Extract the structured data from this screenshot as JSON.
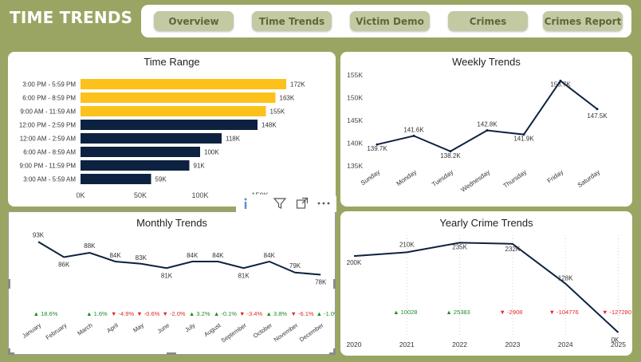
{
  "header": {
    "title": "TIME TRENDS"
  },
  "nav": {
    "items": [
      "Overview",
      "Time Trends",
      "Victim Demo",
      "Crimes",
      "Crimes Report"
    ]
  },
  "colors": {
    "gold": "#fcc21b",
    "navy": "#0d2240",
    "green": "#1e8a2a",
    "red": "#e0262a",
    "olive": "#9ba563"
  },
  "visual_toolbar": {
    "icons": [
      "info-icon",
      "filter-icon",
      "focus-mode-icon",
      "more-options-icon"
    ]
  },
  "time_range": {
    "title": "Time Range",
    "chart_data": {
      "type": "bar",
      "orientation": "horizontal",
      "categories": [
        "3:00 PM - 5:59 PM",
        "6:00 PM - 8:59 PM",
        "9:00 AM - 11:59 AM",
        "12:00 PM - 2:59 PM",
        "12:00 AM - 2:59 AM",
        "6:00 AM - 8:59 AM",
        "9:00 PM - 11:59 PM",
        "3:00 AM - 5:59 AM"
      ],
      "values": [
        172000,
        163000,
        155000,
        148000,
        118000,
        100000,
        91000,
        59000
      ],
      "labels": [
        "172K",
        "163K",
        "155K",
        "148K",
        "118K",
        "100K",
        "91K",
        "59K"
      ],
      "highlight": [
        true,
        true,
        true,
        false,
        false,
        false,
        false,
        false
      ],
      "xlim": [
        0,
        170000
      ],
      "xticks": [
        0,
        50000,
        100000,
        150000
      ],
      "xtick_labels": [
        "0K",
        "50K",
        "100K",
        "150K"
      ]
    }
  },
  "weekly": {
    "title": "Weekly Trends",
    "chart_data": {
      "type": "line",
      "categories": [
        "Sunday",
        "Monday",
        "Tuesday",
        "Wednesday",
        "Thursday",
        "Friday",
        "Saturday"
      ],
      "values": [
        139700,
        141600,
        138200,
        142800,
        141900,
        153700,
        147500
      ],
      "labels": [
        "139.7K",
        "141.6K",
        "138.2K",
        "142.8K",
        "141.9K",
        "153.7K",
        "147.5K"
      ],
      "ylim": [
        135000,
        155000
      ],
      "yticks": [
        135000,
        140000,
        145000,
        150000,
        155000
      ],
      "ytick_labels": [
        "135K",
        "140K",
        "145K",
        "150K",
        "155K"
      ]
    }
  },
  "monthly": {
    "title": "Monthly Trends",
    "chart_data": {
      "type": "line",
      "categories": [
        "January",
        "February",
        "March",
        "April",
        "May",
        "June",
        "July",
        "August",
        "September",
        "October",
        "November",
        "December"
      ],
      "values": [
        93000,
        86000,
        88000,
        84000,
        83000,
        81000,
        84000,
        84000,
        81000,
        84000,
        79000,
        78000
      ],
      "labels": [
        "93K",
        "86K",
        "88K",
        "84K",
        "83K",
        "81K",
        "84K",
        "84K",
        "81K",
        "84K",
        "79K",
        "78K"
      ],
      "ylim": [
        60000,
        100000
      ],
      "changes": [
        "18.6%",
        "",
        "1.6%",
        "-4.9%",
        "-0.6%",
        "-2.0%",
        "3.2%",
        "-0.1%",
        "-3.4%",
        "3.8%",
        "-6.1%",
        "-1.0%"
      ],
      "change_up": [
        true,
        null,
        true,
        false,
        false,
        false,
        true,
        true,
        false,
        true,
        false,
        true
      ]
    }
  },
  "yearly": {
    "title": "Yearly Crime Trends",
    "chart_data": {
      "type": "line",
      "categories": [
        "2020",
        "2021",
        "2022",
        "2023",
        "2024",
        "2025"
      ],
      "values": [
        200000,
        210000,
        235000,
        232000,
        128000,
        0
      ],
      "labels": [
        "200K",
        "210K",
        "235K",
        "232K",
        "128K",
        "0K"
      ],
      "ylim": [
        0,
        240000
      ],
      "changes": [
        "",
        "10028",
        "25383",
        "-2908",
        "-104776",
        "-127280"
      ],
      "change_up": [
        null,
        true,
        true,
        false,
        false,
        false
      ]
    }
  }
}
